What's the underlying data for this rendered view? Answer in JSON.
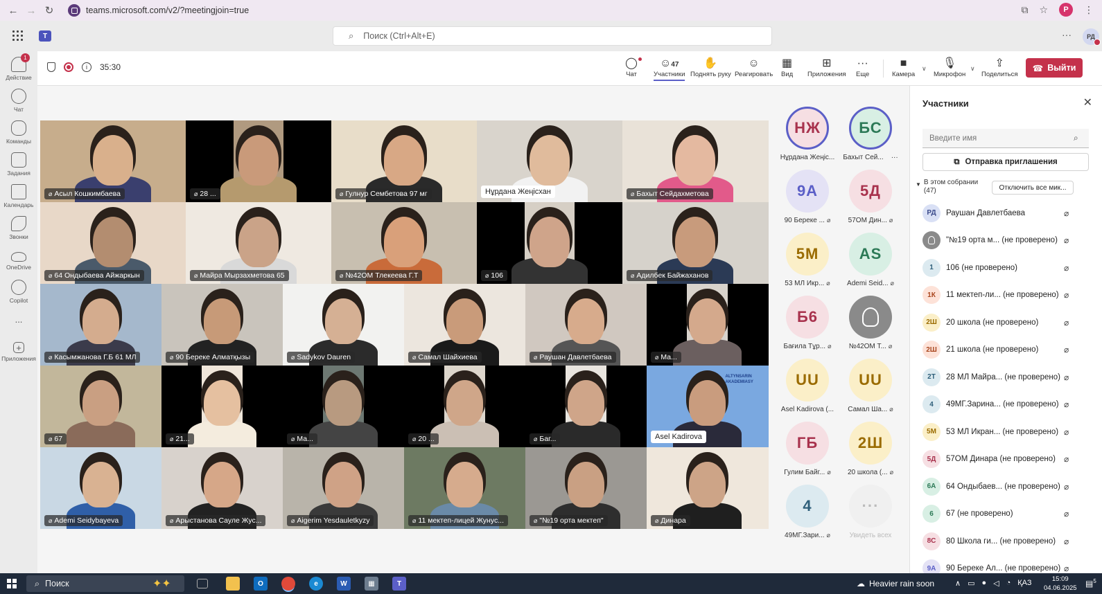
{
  "browser": {
    "url": "teams.microsoft.com/v2/?meetingjoin=true",
    "profile_initial": "P"
  },
  "header": {
    "search_placeholder": "Поиск (Ctrl+Alt+E)",
    "more": "···",
    "avatar_initials": "РД"
  },
  "rail": [
    {
      "label": "Действие",
      "badge": "1"
    },
    {
      "label": "Чат"
    },
    {
      "label": "Команды"
    },
    {
      "label": "Задания"
    },
    {
      "label": "Календарь"
    },
    {
      "label": "Звонки"
    },
    {
      "label": "OneDrive"
    },
    {
      "label": "Copilot"
    },
    {
      "label": "..."
    },
    {
      "label": "Приложения"
    }
  ],
  "toolbar": {
    "timer": "35:30",
    "participants_count": "47",
    "chat": "Чат",
    "participants": "Участники",
    "raise_hand": "Поднять руку",
    "react": "Реагировать",
    "view": "Вид",
    "apps": "Приложения",
    "more": "Еще",
    "camera": "Камера",
    "mic": "Микрофон",
    "share": "Поделиться",
    "leave": "Выйти"
  },
  "tiles": [
    {
      "name": "Асыл Кошкимбаева",
      "muted": true
    },
    {
      "name": "28 ...",
      "muted": true
    },
    {
      "name": "Гулнур Сембетова 97 мг",
      "muted": true
    },
    {
      "name": "Нұрдана Жеңісхан",
      "muted": false
    },
    {
      "name": "Бахыт Сейдахметова",
      "muted": true
    },
    {
      "name": "64 Ондыбаева Айжаркын",
      "muted": true
    },
    {
      "name": "Майра Мырзахметова 65",
      "muted": true
    },
    {
      "name": "№42ОМ Тлекеева Г.Т",
      "muted": true
    },
    {
      "name": "106",
      "muted": true
    },
    {
      "name": "Адилбек Байжаханов",
      "muted": true
    },
    {
      "name": "Касымжанова Г.Б 61 МЛ",
      "muted": true
    },
    {
      "name": "90 Береке Алматқызы",
      "muted": true
    },
    {
      "name": "Sadykov Dauren",
      "muted": true
    },
    {
      "name": "Самал Шайхиева",
      "muted": true
    },
    {
      "name": "Раушан Давлетбаева",
      "muted": true
    },
    {
      "name": "Ма...",
      "muted": true
    },
    {
      "name": "67",
      "muted": true
    },
    {
      "name": "21...",
      "muted": true
    },
    {
      "name": "Ма...",
      "muted": true
    },
    {
      "name": "20 ...",
      "muted": true
    },
    {
      "name": "Баг...",
      "muted": true
    },
    {
      "name": "Asel Kadirova",
      "muted": false
    },
    {
      "name": "Ademi Seidybayeva",
      "muted": true
    },
    {
      "name": "Арыстанова Сауле Жус...",
      "muted": true
    },
    {
      "name": "Aigerim Yesdauletkyzy",
      "muted": true
    },
    {
      "name": "11 мектеп-лицей Жунус...",
      "muted": true
    },
    {
      "name": "\"№19 орта мектеп\"",
      "muted": true
    },
    {
      "name": "Динара",
      "muted": true
    }
  ],
  "logo_text": "ALTYNSARIN AKADEMIASY",
  "gallery": [
    {
      "initials": "НЖ",
      "name": "Нұрдана Жеңіс...",
      "muted": false,
      "bg": "#f6dfe3",
      "fg": "#a8324d",
      "ring": true
    },
    {
      "initials": "БС",
      "name": "Бахыт Сей...",
      "muted": false,
      "bg": "#d8efe4",
      "fg": "#2d7a57",
      "ring": true,
      "more": "···"
    },
    {
      "initials": "9А",
      "name": "90 Береке ...",
      "muted": true,
      "bg": "#e4e2f5",
      "fg": "#5b5fc7"
    },
    {
      "initials": "5Д",
      "name": "57ОМ Дин...",
      "muted": true,
      "bg": "#f6dfe3",
      "fg": "#a8324d"
    },
    {
      "initials": "5М",
      "name": "53 МЛ Икр...",
      "muted": true,
      "bg": "#fbefc8",
      "fg": "#9a6b00"
    },
    {
      "initials": "AS",
      "name": "Ademi Seid...",
      "muted": true,
      "bg": "#d8efe4",
      "fg": "#2d7a57"
    },
    {
      "initials": "Б6",
      "name": "Бағила Тұр...",
      "muted": true,
      "bg": "#f6dfe3",
      "fg": "#a8324d"
    },
    {
      "initials": "",
      "name": "№42ОМ Т...",
      "muted": true,
      "bg": "#8a8a8a",
      "fg": "#ffffff",
      "person": true
    },
    {
      "initials": "UU",
      "name": "Asel Kadirova (...",
      "muted": false,
      "bg": "#fbefc8",
      "fg": "#9a6b00"
    },
    {
      "initials": "UU",
      "name": "Самал Ша...",
      "muted": true,
      "bg": "#fbefc8",
      "fg": "#9a6b00"
    },
    {
      "initials": "ГБ",
      "name": "Гулим Байг...",
      "muted": true,
      "bg": "#f6dfe3",
      "fg": "#a8324d"
    },
    {
      "initials": "2Ш",
      "name": "20 школа (...",
      "muted": true,
      "bg": "#fbefc8",
      "fg": "#9a6b00"
    },
    {
      "initials": "4",
      "name": "49МГ.Зари...",
      "muted": true,
      "bg": "#dceaf0",
      "fg": "#2f5f7a"
    },
    {
      "initials": "···",
      "name": "Увидеть всех",
      "muted": false,
      "bg": "#f0f0f0",
      "fg": "#bbbbbb",
      "see_all": true
    }
  ],
  "panel": {
    "title": "Участники",
    "search_placeholder": "Введите имя",
    "invite": "Отправка приглашения",
    "section_line1": "В этом собрании",
    "section_line2": "(47)",
    "mute_all": "Отключить все мик...",
    "participants": [
      {
        "initials": "РД",
        "name": "Раушан Давлетбаева",
        "bg": "#d9e0f5",
        "fg": "#3a4a8a"
      },
      {
        "initials": "",
        "name": "\"№19 орта м... (не проверено)",
        "bg": "#8a8a8a",
        "fg": "#ffffff",
        "person": true
      },
      {
        "initials": "1",
        "name": "106 (не проверено)",
        "bg": "#dceaf0",
        "fg": "#2f5f7a"
      },
      {
        "initials": "1К",
        "name": "11 мектеп-ли... (не проверено)",
        "bg": "#fde2d8",
        "fg": "#a8451d"
      },
      {
        "initials": "2Ш",
        "name": "20 школа (не проверено)",
        "bg": "#fbefc8",
        "fg": "#9a6b00"
      },
      {
        "initials": "2Ш",
        "name": "21 школа (не проверено)",
        "bg": "#fde2d8",
        "fg": "#a8451d"
      },
      {
        "initials": "2Т",
        "name": "28 МЛ Майра... (не проверено)",
        "bg": "#dceaf0",
        "fg": "#2f5f7a"
      },
      {
        "initials": "4",
        "name": "49МГ.Зарина... (не проверено)",
        "bg": "#dceaf0",
        "fg": "#2f5f7a"
      },
      {
        "initials": "5М",
        "name": "53 МЛ Икран... (не проверено)",
        "bg": "#fbefc8",
        "fg": "#9a6b00"
      },
      {
        "initials": "5Д",
        "name": "57ОМ Динара (не проверено)",
        "bg": "#f6dfe3",
        "fg": "#a8324d"
      },
      {
        "initials": "6А",
        "name": "64 Ондыбаев... (не проверено)",
        "bg": "#d8efe4",
        "fg": "#2d7a57"
      },
      {
        "initials": "6",
        "name": "67 (не проверено)",
        "bg": "#d8efe4",
        "fg": "#2d7a57"
      },
      {
        "initials": "8С",
        "name": "80 Школа ги... (не проверено)",
        "bg": "#f6dfe3",
        "fg": "#a8324d"
      },
      {
        "initials": "9А",
        "name": "90 Береке Ал... (не проверено)",
        "bg": "#e4e2f5",
        "fg": "#5b5fc7"
      }
    ]
  },
  "taskbar": {
    "search": "Поиск",
    "weather": "Heavier rain soon",
    "lang": "ҚАЗ",
    "time": "15:09",
    "date": "04.06.2025",
    "notif_count": "5"
  }
}
